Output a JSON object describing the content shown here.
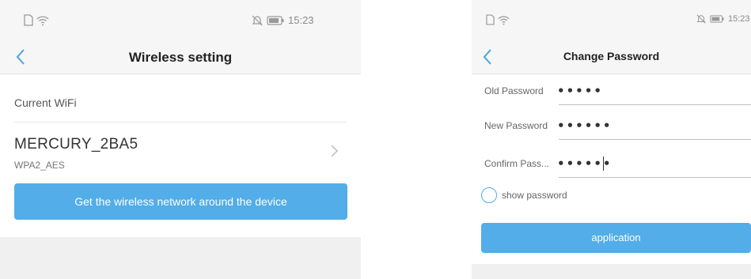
{
  "left_screen": {
    "status_time": "15:23",
    "title": "Wireless setting",
    "current_label": "Current WiFi",
    "wifi_name": "MERCURY_2BA5",
    "wifi_security": "WPA2_AES",
    "scan_button_label": "Get the wireless network around the device",
    "icons": {
      "back": "chevron-left-icon",
      "row_arrow": "chevron-right-icon",
      "sim": "sim-card-icon",
      "wifi": "wifi-icon",
      "mute": "bell-off-icon",
      "battery": "battery-icon"
    }
  },
  "right_screen": {
    "status_time": "15:23",
    "title": "Change Password",
    "fields": [
      {
        "label": "Old Password",
        "value": "•••••"
      },
      {
        "label": "New Password",
        "value": "••••••"
      },
      {
        "label": "Confirm Pass...",
        "value": "••••••"
      }
    ],
    "show_password_label": "show password",
    "show_password_checked": false,
    "apply_button_label": "application"
  },
  "colors": {
    "accent": "#52ade8",
    "status_bar_bg": "#f6f6f6",
    "page_bg": "#f0f0f0"
  }
}
